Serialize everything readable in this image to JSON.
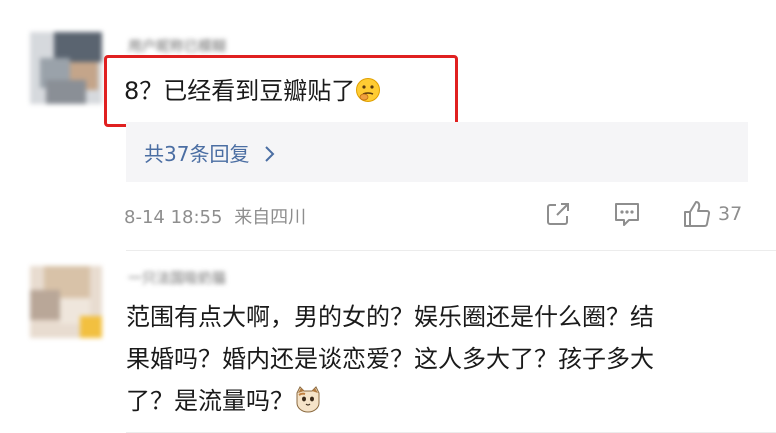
{
  "comments": [
    {
      "username": "用户昵称已模糊",
      "text": "8？已经看到豆瓣贴了",
      "emoji_icon": "thinking-face-icon",
      "replies_label": "共37条回复",
      "date": "8-14 18:55",
      "location": "来自四川",
      "like_count": "37"
    },
    {
      "username": "一只法国吸奶猫",
      "text_lines": [
        "范围有点大啊，男的女的？娱乐圈还是什么圈？结",
        "果婚吗？婚内还是谈恋爱？这人多大了？孩子多大",
        "了？是流量吗？"
      ],
      "emoji_icon": "cat-face-icon"
    }
  ],
  "colors": {
    "highlight": "#e02020",
    "link": "#4b6ea3",
    "meta": "#8e8e8e",
    "reply_bg": "#f5f5f7"
  }
}
